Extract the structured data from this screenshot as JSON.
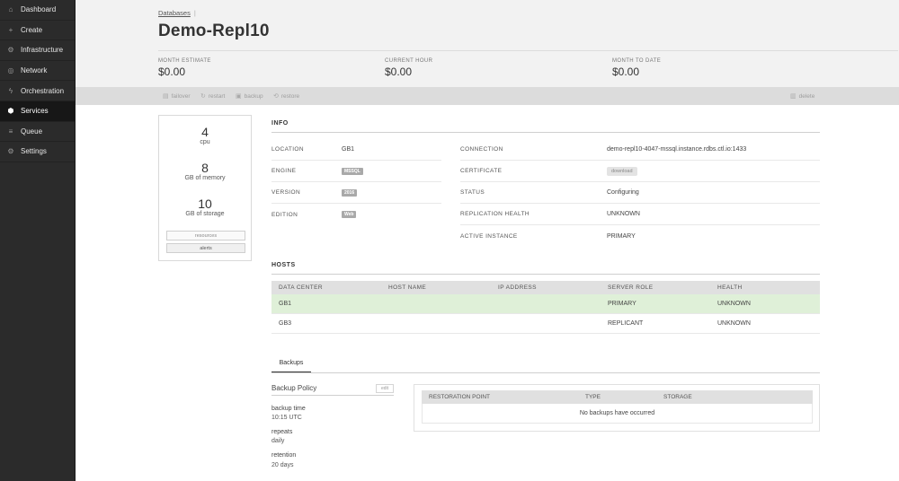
{
  "sidebar": {
    "items": [
      {
        "label": "Dashboard",
        "icon": "home-icon",
        "glyph": "⌂"
      },
      {
        "label": "Create",
        "icon": "plus-icon",
        "glyph": "+"
      },
      {
        "label": "Infrastructure",
        "icon": "gear-icon",
        "glyph": "⚙"
      },
      {
        "label": "Network",
        "icon": "globe-icon",
        "glyph": "◎"
      },
      {
        "label": "Orchestration",
        "icon": "bolt-icon",
        "glyph": "ϟ"
      },
      {
        "label": "Services",
        "icon": "cube-icon",
        "glyph": "⬢"
      },
      {
        "label": "Queue",
        "icon": "list-icon",
        "glyph": "≡"
      },
      {
        "label": "Settings",
        "icon": "gear-icon",
        "glyph": "⚙"
      }
    ],
    "active": "Services"
  },
  "header": {
    "breadcrumb": "Databases",
    "breadcrumb_sep": "|",
    "title": "Demo-Repl10",
    "stats": [
      {
        "label": "MONTH ESTIMATE",
        "value": "$0.00"
      },
      {
        "label": "CURRENT HOUR",
        "value": "$0.00"
      },
      {
        "label": "MONTH TO DATE",
        "value": "$0.00"
      }
    ]
  },
  "toolbar": {
    "failover": "failover",
    "restart": "restart",
    "backup": "backup",
    "restore": "restore",
    "delete": "delete"
  },
  "resources": {
    "cpu_value": "4",
    "cpu_label": "cpu",
    "memory_value": "8",
    "memory_label": "GB of memory",
    "storage_value": "10",
    "storage_label": "GB of storage",
    "resources_btn": "resources",
    "alerts_btn": "alerts"
  },
  "info": {
    "title": "INFO",
    "location_label": "LOCATION",
    "location_value": "GB1",
    "engine_label": "ENGINE",
    "engine_value": "MSSQL",
    "version_label": "VERSION",
    "version_value": "2016",
    "edition_label": "EDITION",
    "edition_value": "Web",
    "connection_label": "CONNECTION",
    "connection_value": "demo-repl10-4047-mssql.instance.rdbs.ctl.io:1433",
    "certificate_label": "CERTIFICATE",
    "certificate_value": "download",
    "status_label": "STATUS",
    "status_value": "Configuring",
    "replication_label": "REPLICATION HEALTH",
    "replication_value": "UNKNOWN",
    "active_label": "ACTIVE INSTANCE",
    "active_value": "PRIMARY"
  },
  "hosts": {
    "title": "HOSTS",
    "columns": [
      "DATA CENTER",
      "HOST NAME",
      "IP ADDRESS",
      "SERVER ROLE",
      "HEALTH"
    ],
    "rows": [
      {
        "dc": "GB1",
        "host": "",
        "ip": "",
        "role": "PRIMARY",
        "health": "UNKNOWN"
      },
      {
        "dc": "GB3",
        "host": "",
        "ip": "",
        "role": "REPLICANT",
        "health": "UNKNOWN"
      }
    ],
    "primary_color": "#dff0d8"
  },
  "backups": {
    "tab": "Backups",
    "policy_title": "Backup Policy",
    "edit": "edit",
    "backup_time_label": "backup time",
    "backup_time_value": "10:15 UTC",
    "repeats_label": "repeats",
    "repeats_value": "daily",
    "retention_label": "retention",
    "retention_value": "20 days",
    "columns": [
      "RESTORATION POINT",
      "TYPE",
      "STORAGE"
    ],
    "empty": "No backups have occurred"
  }
}
